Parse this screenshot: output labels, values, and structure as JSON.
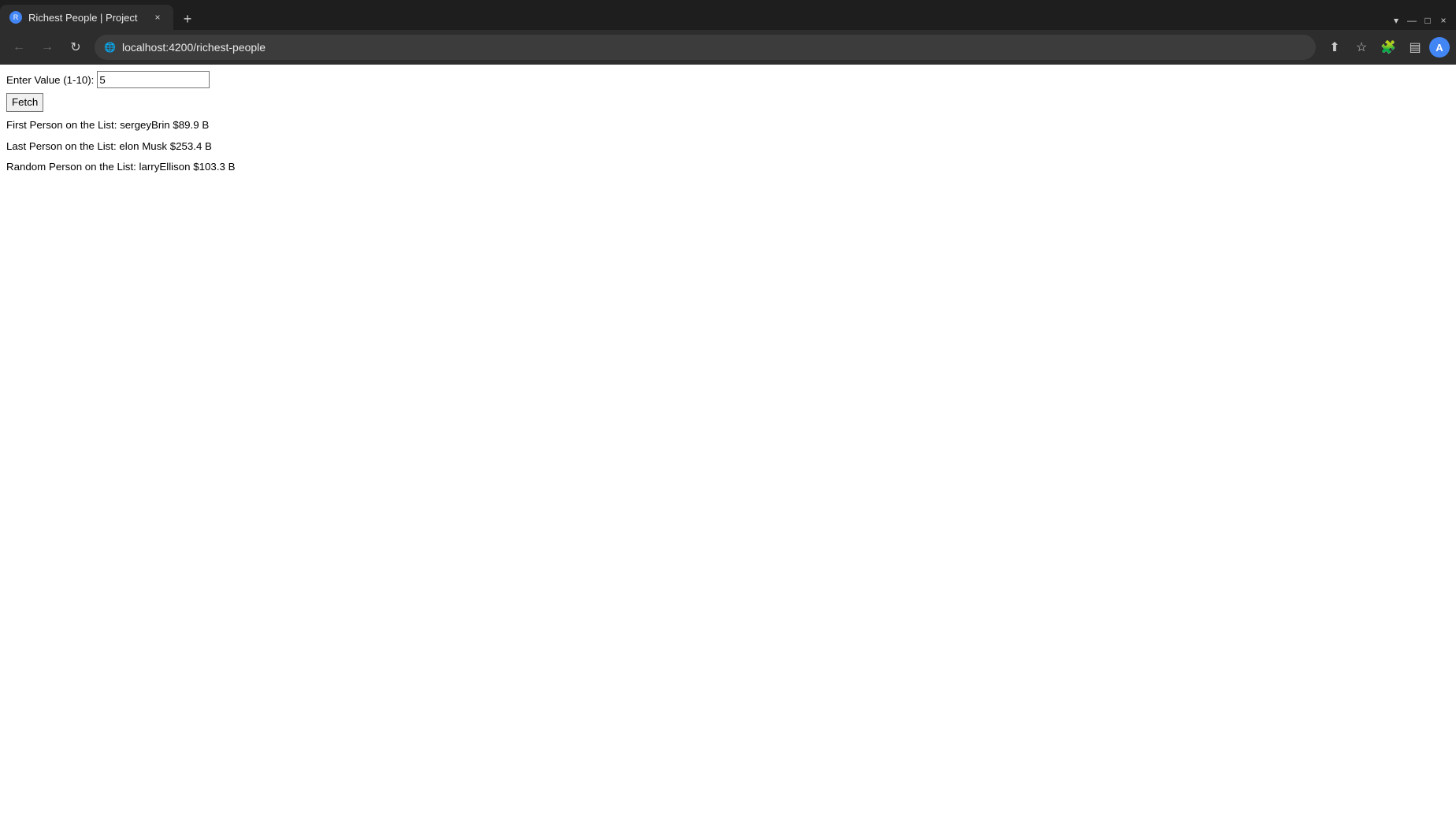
{
  "browser": {
    "tab": {
      "favicon_label": "R",
      "title": "Richest People | Project",
      "close_label": "×",
      "new_tab_label": "+"
    },
    "tab_controls": {
      "dropdown_label": "▾"
    },
    "nav": {
      "back_label": "←",
      "forward_label": "→",
      "reload_label": "↻",
      "url": "localhost:4200/richest-people",
      "share_label": "⬆",
      "bookmark_label": "☆",
      "extensions_label": "🧩",
      "sidebar_label": "▤",
      "profile_label": "A"
    }
  },
  "page": {
    "input_label": "Enter Value (1-10):",
    "input_value": "5",
    "fetch_button": "Fetch",
    "results": {
      "first": "First Person on the List: sergeyBrin $89.9 B",
      "last": "Last Person on the List: elon Musk $253.4 B",
      "random": "Random Person on the List: larryEllison $103.3 B"
    }
  }
}
